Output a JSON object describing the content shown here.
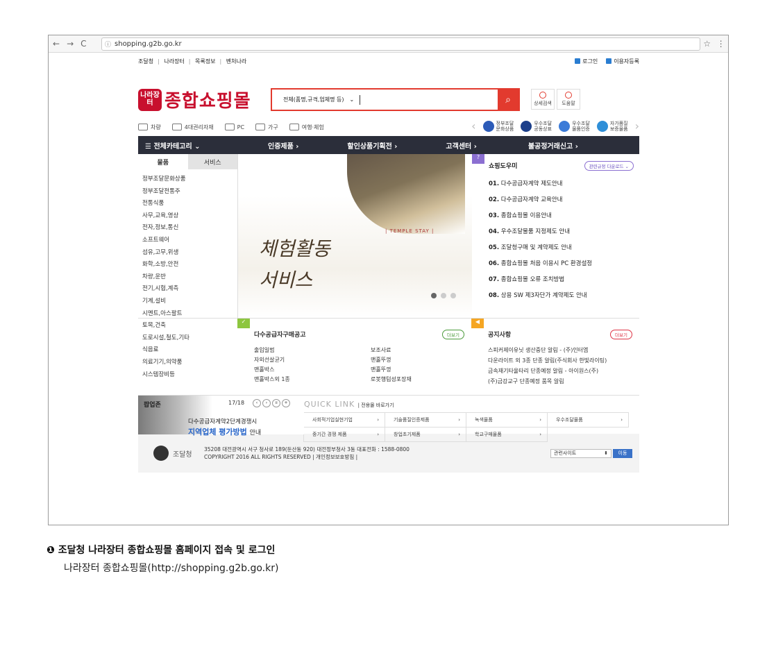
{
  "browser": {
    "url": "shopping.g2b.go.kr",
    "back": "←",
    "forward": "→",
    "reload": "C",
    "star": "☆",
    "menu": "⋮"
  },
  "topbar": {
    "links": [
      "조달청",
      "나라장터",
      "목록정보",
      "벤처나라"
    ],
    "login": "로그인",
    "register": "이용자등록"
  },
  "header": {
    "logo_mark": "나라장터",
    "logo_text": "종합쇼핑몰",
    "search_category": "전체(품명,규격,업체명 등)",
    "detail_search": "상세검색",
    "help": "도움말"
  },
  "categories": [
    "차량",
    "4대권리자재",
    "PC",
    "가구",
    "여행·체험"
  ],
  "partners": [
    {
      "l1": "정부조달",
      "l2": "문화상품"
    },
    {
      "l1": "우수조달",
      "l2": "공동상표"
    },
    {
      "l1": "우수조달",
      "l2": "물품인증"
    },
    {
      "l1": "자가품질",
      "l2": "보증물품"
    }
  ],
  "menu": {
    "all": "☰  전체카테고리  ⌄",
    "items": [
      "인증제품 ›",
      "할인상품기획전 ›",
      "고객센터 ›",
      "불공정거래신고 ›"
    ]
  },
  "leftnav": {
    "tab_goods": "물품",
    "tab_service": "서비스",
    "items": [
      "정부조달문화상품",
      "정부조달전통주",
      "전통식품",
      "사무,교육,영상",
      "전자,정보,통신",
      "소프트웨어",
      "섬유,고무,위생",
      "화학,소방,안전",
      "차량,운반",
      "전기,시험,계측",
      "기계,설비",
      "시멘트,아스팔트",
      "토목,건축",
      "도로시설,철도,기타",
      "식음료",
      "의료기기,의약품",
      "시스템장비등"
    ]
  },
  "banner": {
    "tag": "| TEMPLE STAY |",
    "line1": "체험활동",
    "line2": "서비스"
  },
  "help": {
    "title": "쇼핑도우미",
    "download": "관련규정 다운로드 ⌄",
    "items": [
      {
        "num": "01.",
        "text": "다수공급자계약 제도안내"
      },
      {
        "num": "02.",
        "text": "다수공급자계약 교육안내"
      },
      {
        "num": "03.",
        "text": "종합쇼핑몰 이용안내"
      },
      {
        "num": "04.",
        "text": "우수조달물품 지정제도 안내"
      },
      {
        "num": "05.",
        "text": "조달청구매 및 계약제도 안내"
      },
      {
        "num": "06.",
        "text": "종합쇼핑몰 처음 이용시 PC 환경설정"
      },
      {
        "num": "07.",
        "text": "종합쇼핑몰 오류 조치방법"
      },
      {
        "num": "08.",
        "text": "상용 SW 제3자단가 계약제도 안내"
      }
    ]
  },
  "mas": {
    "title": "다수공급자구매공고",
    "more": "더보기",
    "items": [
      "출입일범",
      "보조사료",
      "자외선살균기",
      "맨홀뚜껑",
      "맨홀박스",
      "맨홀뚜껑",
      "맨홀박스외 1종",
      "로봇행텀성포장재"
    ]
  },
  "notice": {
    "title": "공지사항",
    "more": "더보기",
    "items": [
      "스피커제이유닛 생산중단 알림 - (주)인터엠",
      "다운라이트 외 3종 단종 알림(주식회사 한빛라이팅)",
      "금속재기타울타리 단종예정 알림 - 아이원스(주)",
      "(주)금강교구 단종예정 품목 알림"
    ]
  },
  "popup": {
    "title": "팝업존",
    "counter": "17/18",
    "line1": "다수공급자계약2단계경쟁시",
    "line2": "지역업체 평가방법",
    "line2_suffix": "안내"
  },
  "quicklink": {
    "title": "QUICK LINK",
    "subtitle": "| 전용몰 바로가기",
    "items": [
      "사회적기업실현기업",
      "기술품질인증제품",
      "녹색물품",
      "우수조달물품",
      "중기간 경쟁 제품",
      "창업초기제품",
      "학교구매물품"
    ]
  },
  "footer": {
    "org": "조달청",
    "address": "35208 대전광역시 서구 청사로 189(둔산동 920) 대전정부청사 3동 대표전화 : 1588-0800",
    "copyright": "COPYRIGHT 2016 ALL RIGHTS RESERVED | 개인정보보호방침 |",
    "site_select": "관련사이트",
    "go": "이동"
  },
  "caption": {
    "title": "❶ 조달청 나라장터 종합쇼핑몰 홈페이지 접속 및 로그인",
    "sub": "나라장터 종합쇼핑몰(http://shopping.g2b.go.kr)"
  }
}
